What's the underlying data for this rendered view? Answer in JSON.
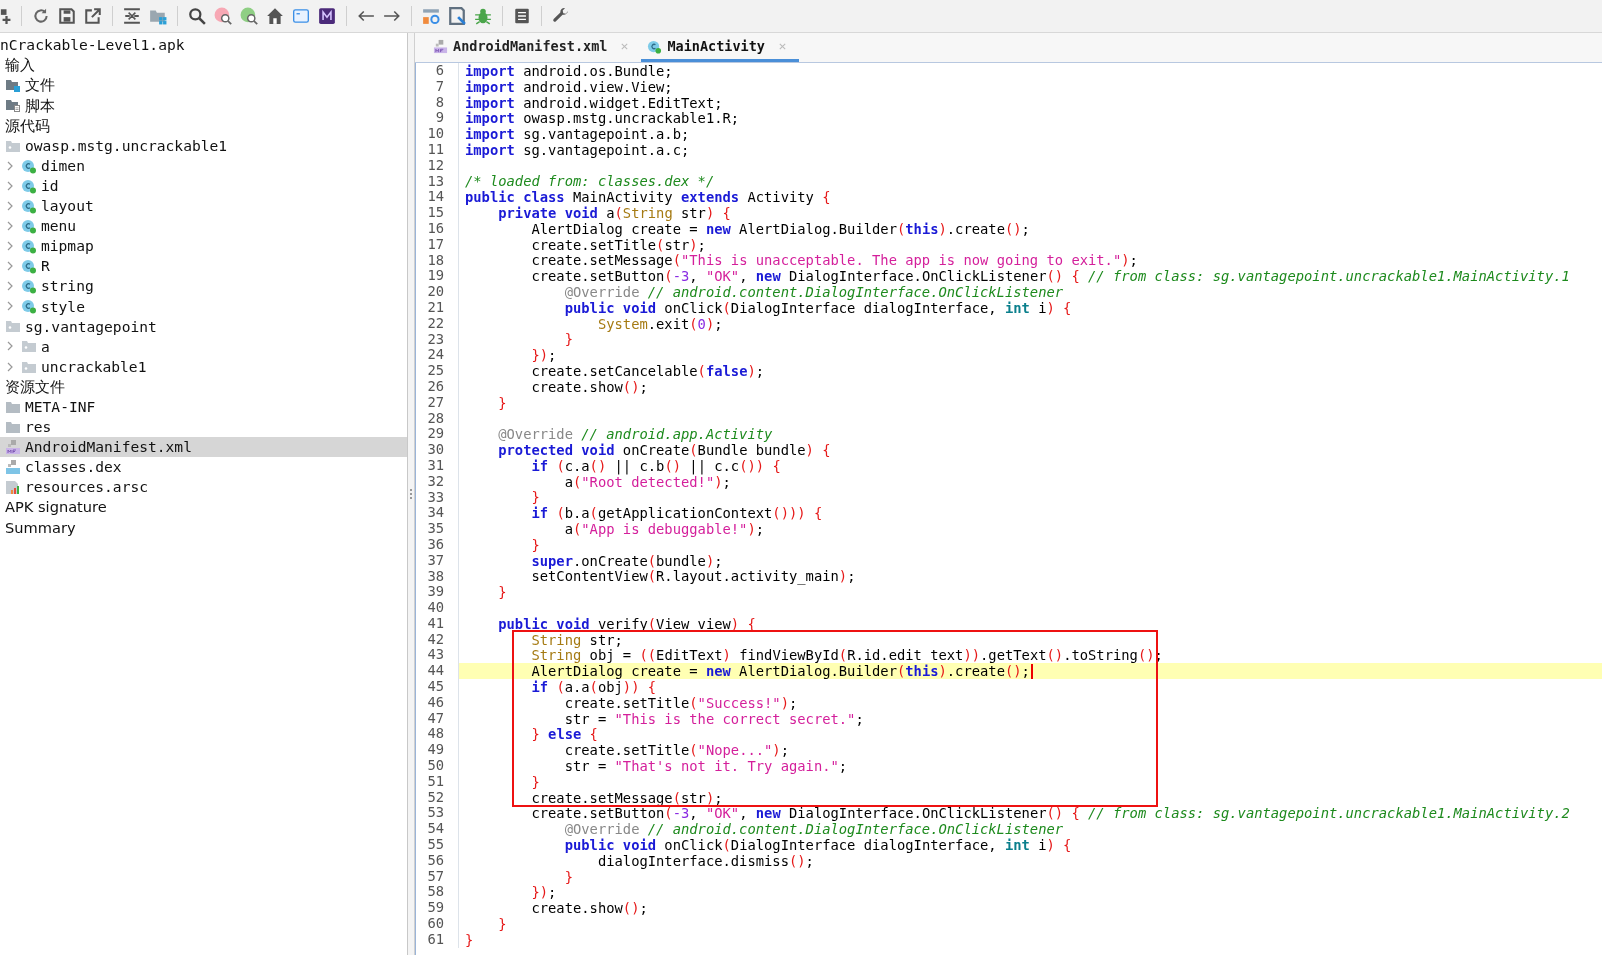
{
  "sidebar": {
    "tree": [
      {
        "label": "nCrackable-Level1.apk",
        "selected": false,
        "children": [
          {
            "label": "输入",
            "selected": false,
            "children": [
              {
                "label": "文件",
                "kind": "files-folder",
                "selected": false
              },
              {
                "label": "脚本",
                "kind": "scripts-folder",
                "selected": false
              }
            ]
          },
          {
            "label": "源代码",
            "selected": false,
            "children": [
              {
                "label": "owasp.mstg.uncrackable1",
                "kind": "package",
                "selected": false,
                "children": [
                  {
                    "label": "dimen",
                    "kind": "class",
                    "selected": false,
                    "expanded": false
                  },
                  {
                    "label": "id",
                    "kind": "class",
                    "selected": false,
                    "expanded": false
                  },
                  {
                    "label": "layout",
                    "kind": "class",
                    "selected": false,
                    "expanded": false
                  },
                  {
                    "label": "menu",
                    "kind": "class",
                    "selected": false,
                    "expanded": false
                  },
                  {
                    "label": "mipmap",
                    "kind": "class",
                    "selected": false,
                    "expanded": false
                  },
                  {
                    "label": "R",
                    "kind": "class",
                    "selected": false,
                    "expanded": false
                  },
                  {
                    "label": "string",
                    "kind": "class",
                    "selected": false,
                    "expanded": false
                  },
                  {
                    "label": "style",
                    "kind": "class",
                    "selected": false,
                    "expanded": false
                  }
                ]
              },
              {
                "label": "sg.vantagepoint",
                "kind": "package",
                "selected": false,
                "children": [
                  {
                    "label": "a",
                    "kind": "package",
                    "selected": false,
                    "expanded": false
                  },
                  {
                    "label": "uncrackable1",
                    "kind": "package",
                    "selected": false,
                    "expanded": false
                  }
                ]
              }
            ]
          },
          {
            "label": "资源文件",
            "selected": false,
            "children": [
              {
                "label": "META-INF",
                "kind": "folder",
                "selected": false
              },
              {
                "label": "res",
                "kind": "folder",
                "selected": false
              },
              {
                "label": "AndroidManifest.xml",
                "kind": "manifest",
                "selected": true
              },
              {
                "label": "classes.dex",
                "kind": "dex",
                "selected": false
              },
              {
                "label": "resources.arsc",
                "kind": "arsc",
                "selected": false
              }
            ]
          },
          {
            "label": "APK signature",
            "selected": false
          },
          {
            "label": "Summary",
            "selected": false
          }
        ]
      }
    ]
  },
  "tabs": [
    {
      "label": "AndroidManifest.xml",
      "kind": "manifest",
      "selected": false
    },
    {
      "label": "MainActivity",
      "kind": "class",
      "selected": true
    }
  ],
  "editor": {
    "lines": [
      {
        "number": "6",
        "current": false,
        "marked": false,
        "tokens": [
          {
            "kind": "kw",
            "text": "import"
          },
          {
            "kind": "plain",
            "text": " android.os.Bundle;"
          }
        ]
      },
      {
        "number": "7",
        "current": false,
        "marked": false,
        "tokens": [
          {
            "kind": "kw",
            "text": "import"
          },
          {
            "kind": "plain",
            "text": " android.view.View;"
          }
        ]
      },
      {
        "number": "8",
        "current": false,
        "marked": false,
        "tokens": [
          {
            "kind": "kw",
            "text": "import"
          },
          {
            "kind": "plain",
            "text": " android.widget.EditText;"
          }
        ]
      },
      {
        "number": "9",
        "current": false,
        "marked": false,
        "tokens": [
          {
            "kind": "kw",
            "text": "import"
          },
          {
            "kind": "plain",
            "text": " owasp.mstg.uncrackable1.R;"
          }
        ]
      },
      {
        "number": "10",
        "current": false,
        "marked": false,
        "tokens": [
          {
            "kind": "kw",
            "text": "import"
          },
          {
            "kind": "plain",
            "text": " sg.vantagepoint.a.b;"
          }
        ]
      },
      {
        "number": "11",
        "current": false,
        "marked": false,
        "tokens": [
          {
            "kind": "kw",
            "text": "import"
          },
          {
            "kind": "plain",
            "text": " sg.vantagepoint.a.c;"
          }
        ]
      },
      {
        "number": "12",
        "current": false,
        "marked": false
      },
      {
        "number": "13",
        "current": false,
        "marked": false,
        "tokens": [
          {
            "kind": "comment",
            "text": "/* loaded from: classes.dex */"
          }
        ]
      },
      {
        "number": "14",
        "current": false,
        "marked": false,
        "tokens": [
          {
            "kind": "kw",
            "text": "public class"
          },
          {
            "kind": "plain",
            "text": " MainActivity "
          },
          {
            "kind": "kw",
            "text": "extends"
          },
          {
            "kind": "plain",
            "text": " Activity "
          },
          {
            "kind": "punct",
            "text": "{"
          }
        ]
      },
      {
        "number": "15",
        "current": false,
        "marked": false,
        "tokens": [
          {
            "kind": "kw",
            "text": "    private void"
          },
          {
            "kind": "plain",
            "text": " a"
          },
          {
            "kind": "punct",
            "text": "("
          },
          {
            "kind": "type",
            "text": "String"
          },
          {
            "kind": "plain",
            "text": " str"
          },
          {
            "kind": "punct",
            "text": ") {"
          }
        ]
      },
      {
        "number": "16",
        "current": false,
        "marked": false,
        "tokens": [
          {
            "kind": "plain",
            "text": "        AlertDialog create = "
          },
          {
            "kind": "kw",
            "text": "new"
          },
          {
            "kind": "plain",
            "text": " AlertDialog.Builder"
          },
          {
            "kind": "punct",
            "text": "("
          },
          {
            "kind": "kw",
            "text": "this"
          },
          {
            "kind": "punct",
            "text": ")"
          },
          {
            "kind": "plain",
            "text": ".create"
          },
          {
            "kind": "punct",
            "text": "()"
          },
          {
            "kind": "plain",
            "text": ";"
          }
        ]
      },
      {
        "number": "17",
        "current": false,
        "marked": false,
        "tokens": [
          {
            "kind": "plain",
            "text": "        create.setTitle"
          },
          {
            "kind": "punct",
            "text": "("
          },
          {
            "kind": "plain",
            "text": "str"
          },
          {
            "kind": "punct",
            "text": ")"
          },
          {
            "kind": "plain",
            "text": ";"
          }
        ]
      },
      {
        "number": "18",
        "current": false,
        "marked": false,
        "tokens": [
          {
            "kind": "plain",
            "text": "        create.setMessage"
          },
          {
            "kind": "punct",
            "text": "("
          },
          {
            "kind": "string",
            "text": "\"This is unacceptable. The app is now going to exit.\""
          },
          {
            "kind": "punct",
            "text": ")"
          },
          {
            "kind": "plain",
            "text": ";"
          }
        ]
      },
      {
        "number": "19",
        "current": false,
        "marked": false,
        "tokens": [
          {
            "kind": "plain",
            "text": "        create.setButton"
          },
          {
            "kind": "punct",
            "text": "("
          },
          {
            "kind": "number",
            "text": "-3"
          },
          {
            "kind": "plain",
            "text": ", "
          },
          {
            "kind": "string",
            "text": "\"OK\""
          },
          {
            "kind": "plain",
            "text": ", "
          },
          {
            "kind": "kw",
            "text": "new"
          },
          {
            "kind": "plain",
            "text": " DialogInterface.OnClickListener"
          },
          {
            "kind": "punct",
            "text": "() { "
          },
          {
            "kind": "comment",
            "text": "// from class: sg.vantagepoint.uncrackable1.MainActivity.1"
          }
        ]
      },
      {
        "number": "20",
        "current": false,
        "marked": false,
        "tokens": [
          {
            "kind": "annotation",
            "text": "            @Override "
          },
          {
            "kind": "comment",
            "text": "// android.content.DialogInterface.OnClickListener"
          }
        ]
      },
      {
        "number": "21",
        "current": false,
        "marked": false,
        "tokens": [
          {
            "kind": "kw",
            "text": "            public void"
          },
          {
            "kind": "plain",
            "text": " onClick"
          },
          {
            "kind": "punct",
            "text": "("
          },
          {
            "kind": "plain",
            "text": "DialogInterface dialogInterface, "
          },
          {
            "kind": "primitive",
            "text": "int"
          },
          {
            "kind": "plain",
            "text": " i"
          },
          {
            "kind": "punct",
            "text": ") {"
          }
        ]
      },
      {
        "number": "22",
        "current": false,
        "marked": false,
        "tokens": [
          {
            "kind": "type",
            "text": "                System"
          },
          {
            "kind": "plain",
            "text": ".exit"
          },
          {
            "kind": "punct",
            "text": "("
          },
          {
            "kind": "number",
            "text": "0"
          },
          {
            "kind": "punct",
            "text": ")"
          },
          {
            "kind": "plain",
            "text": ";"
          }
        ]
      },
      {
        "number": "23",
        "current": false,
        "marked": false,
        "tokens": [
          {
            "kind": "punct",
            "text": "            }"
          }
        ]
      },
      {
        "number": "24",
        "current": false,
        "marked": false,
        "tokens": [
          {
            "kind": "punct",
            "text": "        })"
          },
          {
            "kind": "plain",
            "text": ";"
          }
        ]
      },
      {
        "number": "25",
        "current": false,
        "marked": false,
        "tokens": [
          {
            "kind": "plain",
            "text": "        create.setCancelable"
          },
          {
            "kind": "punct",
            "text": "("
          },
          {
            "kind": "kw",
            "text": "false"
          },
          {
            "kind": "punct",
            "text": ")"
          },
          {
            "kind": "plain",
            "text": ";"
          }
        ]
      },
      {
        "number": "26",
        "current": false,
        "marked": false,
        "tokens": [
          {
            "kind": "plain",
            "text": "        create.show"
          },
          {
            "kind": "punct",
            "text": "()"
          },
          {
            "kind": "plain",
            "text": ";"
          }
        ]
      },
      {
        "number": "27",
        "current": false,
        "marked": false,
        "tokens": [
          {
            "kind": "punct",
            "text": "    }"
          }
        ]
      },
      {
        "number": "28",
        "current": false,
        "marked": false
      },
      {
        "number": "29",
        "current": false,
        "marked": false,
        "tokens": [
          {
            "kind": "annotation",
            "text": "    @Override "
          },
          {
            "kind": "comment",
            "text": "// android.app.Activity"
          }
        ]
      },
      {
        "number": "30",
        "current": false,
        "marked": false,
        "tokens": [
          {
            "kind": "kw",
            "text": "    protected void"
          },
          {
            "kind": "plain",
            "text": " onCreate"
          },
          {
            "kind": "punct",
            "text": "("
          },
          {
            "kind": "plain",
            "text": "Bundle bundle"
          },
          {
            "kind": "punct",
            "text": ") {"
          }
        ]
      },
      {
        "number": "31",
        "current": false,
        "marked": false,
        "tokens": [
          {
            "kind": "kw",
            "text": "        if "
          },
          {
            "kind": "punct",
            "text": "("
          },
          {
            "kind": "plain",
            "text": "c.a"
          },
          {
            "kind": "punct",
            "text": "()"
          },
          {
            "kind": "plain",
            "text": " || c.b"
          },
          {
            "kind": "punct",
            "text": "()"
          },
          {
            "kind": "plain",
            "text": " || c.c"
          },
          {
            "kind": "punct",
            "text": "()) {"
          }
        ]
      },
      {
        "number": "32",
        "current": false,
        "marked": false,
        "tokens": [
          {
            "kind": "plain",
            "text": "            a"
          },
          {
            "kind": "punct",
            "text": "("
          },
          {
            "kind": "string",
            "text": "\"Root detected!\""
          },
          {
            "kind": "punct",
            "text": ")"
          },
          {
            "kind": "plain",
            "text": ";"
          }
        ]
      },
      {
        "number": "33",
        "current": false,
        "marked": false,
        "tokens": [
          {
            "kind": "punct",
            "text": "        }"
          }
        ]
      },
      {
        "number": "34",
        "current": false,
        "marked": false,
        "tokens": [
          {
            "kind": "kw",
            "text": "        if "
          },
          {
            "kind": "punct",
            "text": "("
          },
          {
            "kind": "plain",
            "text": "b.a"
          },
          {
            "kind": "punct",
            "text": "("
          },
          {
            "kind": "plain",
            "text": "getApplicationContext"
          },
          {
            "kind": "punct",
            "text": "())) {"
          }
        ]
      },
      {
        "number": "35",
        "current": false,
        "marked": false,
        "tokens": [
          {
            "kind": "plain",
            "text": "            a"
          },
          {
            "kind": "punct",
            "text": "("
          },
          {
            "kind": "string",
            "text": "\"App is debuggable!\""
          },
          {
            "kind": "punct",
            "text": ")"
          },
          {
            "kind": "plain",
            "text": ";"
          }
        ]
      },
      {
        "number": "36",
        "current": false,
        "marked": false,
        "tokens": [
          {
            "kind": "punct",
            "text": "        }"
          }
        ]
      },
      {
        "number": "37",
        "current": false,
        "marked": false,
        "tokens": [
          {
            "kind": "kw",
            "text": "        super"
          },
          {
            "kind": "plain",
            "text": ".onCreate"
          },
          {
            "kind": "punct",
            "text": "("
          },
          {
            "kind": "plain",
            "text": "bundle"
          },
          {
            "kind": "punct",
            "text": ")"
          },
          {
            "kind": "plain",
            "text": ";"
          }
        ]
      },
      {
        "number": "38",
        "current": false,
        "marked": false,
        "tokens": [
          {
            "kind": "plain",
            "text": "        setContentView"
          },
          {
            "kind": "punct",
            "text": "("
          },
          {
            "kind": "plain",
            "text": "R.layout.activity_main"
          },
          {
            "kind": "punct",
            "text": ")"
          },
          {
            "kind": "plain",
            "text": ";"
          }
        ]
      },
      {
        "number": "39",
        "current": false,
        "marked": false,
        "tokens": [
          {
            "kind": "punct",
            "text": "    }"
          }
        ]
      },
      {
        "number": "40",
        "current": false,
        "marked": false
      },
      {
        "number": "41",
        "current": false,
        "marked": false,
        "tokens": [
          {
            "kind": "kw",
            "text": "    public void"
          },
          {
            "kind": "plain",
            "text": " verify"
          },
          {
            "kind": "punct",
            "text": "("
          },
          {
            "kind": "plain",
            "text": "View view"
          },
          {
            "kind": "punct",
            "text": ") {"
          }
        ]
      },
      {
        "number": "42",
        "current": false,
        "marked": true,
        "tokens": [
          {
            "kind": "type",
            "text": "        String"
          },
          {
            "kind": "plain",
            "text": " str;"
          }
        ]
      },
      {
        "number": "43",
        "current": false,
        "marked": true,
        "tokens": [
          {
            "kind": "type",
            "text": "        String"
          },
          {
            "kind": "plain",
            "text": " obj = "
          },
          {
            "kind": "punct",
            "text": "(("
          },
          {
            "kind": "plain",
            "text": "EditText"
          },
          {
            "kind": "punct",
            "text": ")"
          },
          {
            "kind": "plain",
            "text": " findViewById"
          },
          {
            "kind": "punct",
            "text": "("
          },
          {
            "kind": "plain",
            "text": "R.id.edit_text"
          },
          {
            "kind": "punct",
            "text": "))"
          },
          {
            "kind": "plain",
            "text": ".getText"
          },
          {
            "kind": "punct",
            "text": "()"
          },
          {
            "kind": "plain",
            "text": ".toString"
          },
          {
            "kind": "punct",
            "text": "()"
          },
          {
            "kind": "plain",
            "text": ";"
          }
        ]
      },
      {
        "number": "44",
        "current": true,
        "marked": true,
        "tokens": [
          {
            "kind": "plain",
            "text": "        AlertDialog create = "
          },
          {
            "kind": "kw",
            "text": "new"
          },
          {
            "kind": "plain",
            "text": " AlertDialog.Builder"
          },
          {
            "kind": "punct",
            "text": "("
          },
          {
            "kind": "kw",
            "text": "this"
          },
          {
            "kind": "punct",
            "text": ")"
          },
          {
            "kind": "plain",
            "text": ".create"
          },
          {
            "kind": "punct",
            "text": "()"
          },
          {
            "kind": "plain",
            "text": ";"
          }
        ]
      },
      {
        "number": "45",
        "current": false,
        "marked": true,
        "tokens": [
          {
            "kind": "kw",
            "text": "        if "
          },
          {
            "kind": "punct",
            "text": "("
          },
          {
            "kind": "plain",
            "text": "a.a"
          },
          {
            "kind": "punct",
            "text": "("
          },
          {
            "kind": "plain",
            "text": "obj"
          },
          {
            "kind": "punct",
            "text": ")) {"
          }
        ]
      },
      {
        "number": "46",
        "current": false,
        "marked": true,
        "tokens": [
          {
            "kind": "plain",
            "text": "            create.setTitle"
          },
          {
            "kind": "punct",
            "text": "("
          },
          {
            "kind": "string",
            "text": "\"Success!\""
          },
          {
            "kind": "punct",
            "text": ")"
          },
          {
            "kind": "plain",
            "text": ";"
          }
        ]
      },
      {
        "number": "47",
        "current": false,
        "marked": true,
        "tokens": [
          {
            "kind": "plain",
            "text": "            str = "
          },
          {
            "kind": "string",
            "text": "\"This is the correct secret.\""
          },
          {
            "kind": "plain",
            "text": ";"
          }
        ]
      },
      {
        "number": "48",
        "current": false,
        "marked": true,
        "tokens": [
          {
            "kind": "punct",
            "text": "        } "
          },
          {
            "kind": "kw",
            "text": "else"
          },
          {
            "kind": "punct",
            "text": " {"
          }
        ]
      },
      {
        "number": "49",
        "current": false,
        "marked": true,
        "tokens": [
          {
            "kind": "plain",
            "text": "            create.setTitle"
          },
          {
            "kind": "punct",
            "text": "("
          },
          {
            "kind": "string",
            "text": "\"Nope...\""
          },
          {
            "kind": "punct",
            "text": ")"
          },
          {
            "kind": "plain",
            "text": ";"
          }
        ]
      },
      {
        "number": "50",
        "current": false,
        "marked": true,
        "tokens": [
          {
            "kind": "plain",
            "text": "            str = "
          },
          {
            "kind": "string",
            "text": "\"That's not it. Try again.\""
          },
          {
            "kind": "plain",
            "text": ";"
          }
        ]
      },
      {
        "number": "51",
        "current": false,
        "marked": true,
        "tokens": [
          {
            "kind": "punct",
            "text": "        }"
          }
        ]
      },
      {
        "number": "52",
        "current": false,
        "marked": true,
        "tokens": [
          {
            "kind": "plain",
            "text": "        create.setMessage"
          },
          {
            "kind": "punct",
            "text": "("
          },
          {
            "kind": "plain",
            "text": "str"
          },
          {
            "kind": "punct",
            "text": ")"
          },
          {
            "kind": "plain",
            "text": ";"
          }
        ]
      },
      {
        "number": "53",
        "current": false,
        "marked": false,
        "tokens": [
          {
            "kind": "plain",
            "text": "        create.setButton"
          },
          {
            "kind": "punct",
            "text": "("
          },
          {
            "kind": "number",
            "text": "-3"
          },
          {
            "kind": "plain",
            "text": ", "
          },
          {
            "kind": "string",
            "text": "\"OK\""
          },
          {
            "kind": "plain",
            "text": ", "
          },
          {
            "kind": "kw",
            "text": "new"
          },
          {
            "kind": "plain",
            "text": " DialogInterface.OnClickListener"
          },
          {
            "kind": "punct",
            "text": "() { "
          },
          {
            "kind": "comment",
            "text": "// from class: sg.vantagepoint.uncrackable1.MainActivity.2"
          }
        ]
      },
      {
        "number": "54",
        "current": false,
        "marked": false,
        "tokens": [
          {
            "kind": "annotation",
            "text": "            @Override "
          },
          {
            "kind": "comment",
            "text": "// android.content.DialogInterface.OnClickListener"
          }
        ]
      },
      {
        "number": "55",
        "current": false,
        "marked": false,
        "tokens": [
          {
            "kind": "kw",
            "text": "            public void"
          },
          {
            "kind": "plain",
            "text": " onClick"
          },
          {
            "kind": "punct",
            "text": "("
          },
          {
            "kind": "plain",
            "text": "DialogInterface dialogInterface, "
          },
          {
            "kind": "primitive",
            "text": "int"
          },
          {
            "kind": "plain",
            "text": " i"
          },
          {
            "kind": "punct",
            "text": ") {"
          }
        ]
      },
      {
        "number": "56",
        "current": false,
        "marked": false,
        "tokens": [
          {
            "kind": "plain",
            "text": "                dialogInterface.dismiss"
          },
          {
            "kind": "punct",
            "text": "()"
          },
          {
            "kind": "plain",
            "text": ";"
          }
        ]
      },
      {
        "number": "57",
        "current": false,
        "marked": false,
        "tokens": [
          {
            "kind": "punct",
            "text": "            }"
          }
        ]
      },
      {
        "number": "58",
        "current": false,
        "marked": false,
        "tokens": [
          {
            "kind": "punct",
            "text": "        })"
          },
          {
            "kind": "plain",
            "text": ";"
          }
        ]
      },
      {
        "number": "59",
        "current": false,
        "marked": false,
        "tokens": [
          {
            "kind": "plain",
            "text": "        create.show"
          },
          {
            "kind": "punct",
            "text": "()"
          },
          {
            "kind": "plain",
            "text": ";"
          }
        ]
      },
      {
        "number": "60",
        "current": false,
        "marked": false,
        "tokens": [
          {
            "kind": "punct",
            "text": "    }"
          }
        ]
      },
      {
        "number": "61",
        "current": false,
        "marked": false,
        "tokens": [
          {
            "kind": "punct",
            "text": "}"
          }
        ]
      }
    ]
  }
}
